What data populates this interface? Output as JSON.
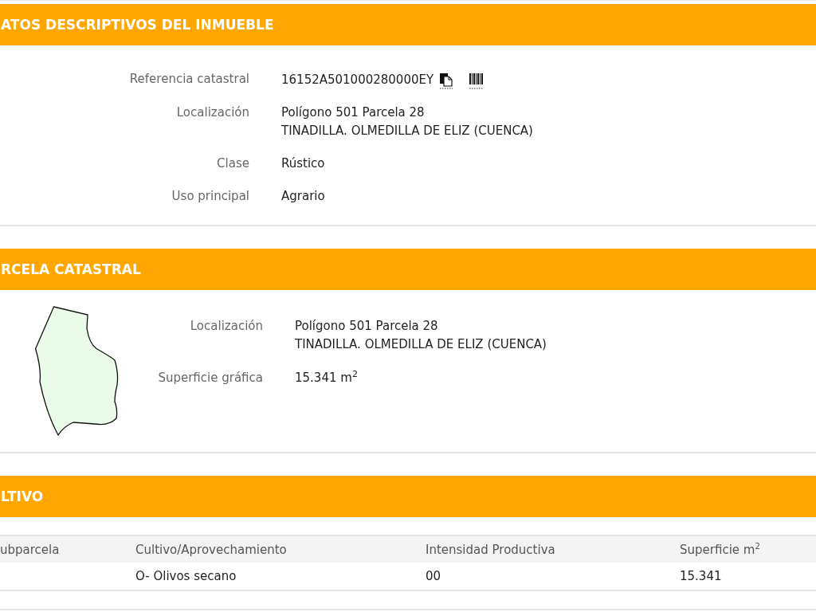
{
  "sections": [
    {
      "kind": "details",
      "title": "ATOS DESCRIPTIVOS DEL INMUEBLE",
      "fields": [
        {
          "kind": "reference",
          "label": "Referencia catastral",
          "lines": [
            "16152A501000280000EY"
          ]
        },
        {
          "kind": "text",
          "label": "Localización",
          "lines": [
            "Polígono 501 Parcela 28",
            "TINADILLA. OLMEDILLA DE ELIZ (CUENCA)"
          ]
        },
        {
          "kind": "text",
          "label": "Clase",
          "lines": [
            "Rústico"
          ]
        },
        {
          "kind": "text",
          "label": "Uso principal",
          "lines": [
            "Agrario"
          ]
        }
      ]
    },
    {
      "kind": "parcel",
      "title": "RCELA CATASTRAL",
      "fields": [
        {
          "kind": "text",
          "label": "Localización",
          "lines": [
            "Polígono 501 Parcela 28",
            "TINADILLA. OLMEDILLA DE ELIZ (CUENCA)"
          ]
        },
        {
          "kind": "text",
          "label": "Superficie gráfica",
          "lines": [
            "15.341 m$^{2}$"
          ]
        }
      ]
    },
    {
      "kind": "table",
      "title": "LTIVO",
      "columns": [
        "ubparcela",
        "Cultivo/Aprovechamiento",
        "Intensidad Productiva",
        "Superficie m$^{2}$"
      ],
      "rows": [
        {
          "cells": [
            "",
            "O- Olivos secano",
            "00",
            "15.341"
          ]
        }
      ]
    }
  ]
}
